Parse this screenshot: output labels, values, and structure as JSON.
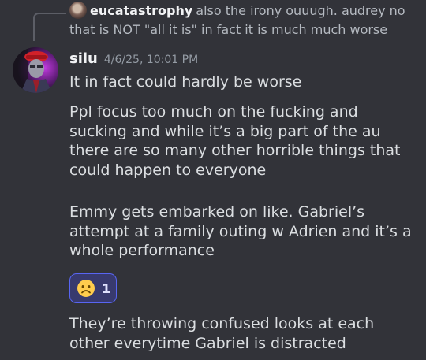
{
  "reply": {
    "author": "eucatastrophy",
    "text": "also the irony ouuugh. audrey no that is NOT \"all it is\" in fact it is much much worse"
  },
  "message": {
    "author": "silu",
    "timestamp": "4/6/25, 10:01 PM",
    "lines": [
      "It in fact could hardly be worse",
      "Ppl focus too much on the fucking and sucking and while it’s a big part of the au there are so many other horrible things that could happen to everyone",
      "Emmy gets embarked on like. Gabriel’s attempt at a family outing w Adrien and it’s a whole performance",
      "They’re throwing confused looks at each other everytime Gabriel is distracted"
    ]
  },
  "reaction": {
    "emoji_icon": "frowning-face-icon",
    "count": "1",
    "accent_color": "#5865f2"
  },
  "colors": {
    "background": "#323339",
    "username": "#f2f3f5",
    "text": "#dbdee1",
    "muted": "#949ba4"
  }
}
